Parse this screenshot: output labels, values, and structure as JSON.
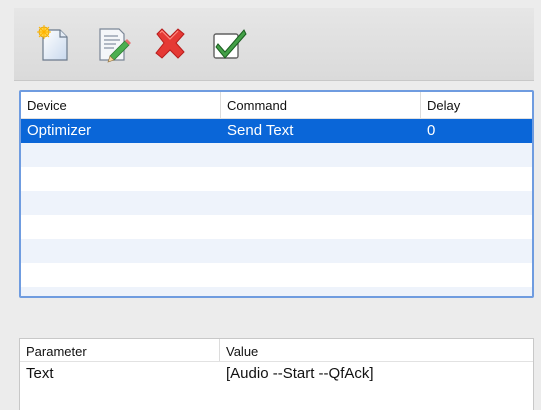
{
  "toolbar": {
    "buttons": [
      {
        "name": "new-command",
        "icon": "new-document-icon"
      },
      {
        "name": "edit-command",
        "icon": "edit-document-icon"
      },
      {
        "name": "delete-command",
        "icon": "delete-x-icon"
      },
      {
        "name": "confirm-command",
        "icon": "checkmark-icon"
      }
    ]
  },
  "commands": {
    "headers": {
      "device": "Device",
      "command": "Command",
      "delay": "Delay"
    },
    "rows": [
      {
        "device": "Optimizer",
        "command": "Send Text",
        "delay": "0",
        "selected": true
      }
    ],
    "empty_rows": 7,
    "selection_color": "#0a66d8",
    "alt_row_color": "#eef3fb"
  },
  "parameters": {
    "headers": {
      "parameter": "Parameter",
      "value": "Value"
    },
    "rows": [
      {
        "parameter": "Text",
        "value": "[Audio --Start --QfAck]"
      }
    ]
  }
}
